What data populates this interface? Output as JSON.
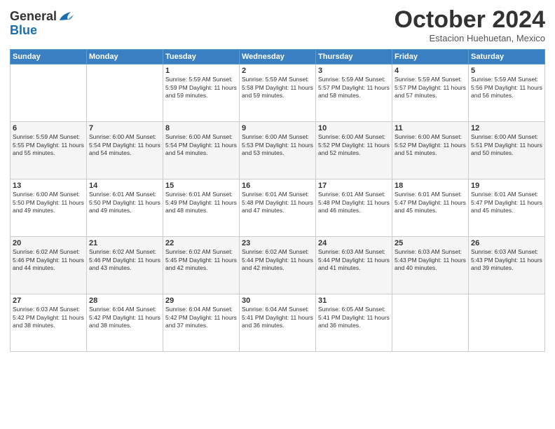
{
  "header": {
    "logo_general": "General",
    "logo_blue": "Blue",
    "month_title": "October 2024",
    "location": "Estacion Huehuetan, Mexico"
  },
  "weekdays": [
    "Sunday",
    "Monday",
    "Tuesday",
    "Wednesday",
    "Thursday",
    "Friday",
    "Saturday"
  ],
  "weeks": [
    [
      {
        "day": "",
        "info": ""
      },
      {
        "day": "",
        "info": ""
      },
      {
        "day": "1",
        "info": "Sunrise: 5:59 AM\nSunset: 5:59 PM\nDaylight: 11 hours and 59 minutes."
      },
      {
        "day": "2",
        "info": "Sunrise: 5:59 AM\nSunset: 5:58 PM\nDaylight: 11 hours and 59 minutes."
      },
      {
        "day": "3",
        "info": "Sunrise: 5:59 AM\nSunset: 5:57 PM\nDaylight: 11 hours and 58 minutes."
      },
      {
        "day": "4",
        "info": "Sunrise: 5:59 AM\nSunset: 5:57 PM\nDaylight: 11 hours and 57 minutes."
      },
      {
        "day": "5",
        "info": "Sunrise: 5:59 AM\nSunset: 5:56 PM\nDaylight: 11 hours and 56 minutes."
      }
    ],
    [
      {
        "day": "6",
        "info": "Sunrise: 5:59 AM\nSunset: 5:55 PM\nDaylight: 11 hours and 55 minutes."
      },
      {
        "day": "7",
        "info": "Sunrise: 6:00 AM\nSunset: 5:54 PM\nDaylight: 11 hours and 54 minutes."
      },
      {
        "day": "8",
        "info": "Sunrise: 6:00 AM\nSunset: 5:54 PM\nDaylight: 11 hours and 54 minutes."
      },
      {
        "day": "9",
        "info": "Sunrise: 6:00 AM\nSunset: 5:53 PM\nDaylight: 11 hours and 53 minutes."
      },
      {
        "day": "10",
        "info": "Sunrise: 6:00 AM\nSunset: 5:52 PM\nDaylight: 11 hours and 52 minutes."
      },
      {
        "day": "11",
        "info": "Sunrise: 6:00 AM\nSunset: 5:52 PM\nDaylight: 11 hours and 51 minutes."
      },
      {
        "day": "12",
        "info": "Sunrise: 6:00 AM\nSunset: 5:51 PM\nDaylight: 11 hours and 50 minutes."
      }
    ],
    [
      {
        "day": "13",
        "info": "Sunrise: 6:00 AM\nSunset: 5:50 PM\nDaylight: 11 hours and 49 minutes."
      },
      {
        "day": "14",
        "info": "Sunrise: 6:01 AM\nSunset: 5:50 PM\nDaylight: 11 hours and 49 minutes."
      },
      {
        "day": "15",
        "info": "Sunrise: 6:01 AM\nSunset: 5:49 PM\nDaylight: 11 hours and 48 minutes."
      },
      {
        "day": "16",
        "info": "Sunrise: 6:01 AM\nSunset: 5:48 PM\nDaylight: 11 hours and 47 minutes."
      },
      {
        "day": "17",
        "info": "Sunrise: 6:01 AM\nSunset: 5:48 PM\nDaylight: 11 hours and 46 minutes."
      },
      {
        "day": "18",
        "info": "Sunrise: 6:01 AM\nSunset: 5:47 PM\nDaylight: 11 hours and 45 minutes."
      },
      {
        "day": "19",
        "info": "Sunrise: 6:01 AM\nSunset: 5:47 PM\nDaylight: 11 hours and 45 minutes."
      }
    ],
    [
      {
        "day": "20",
        "info": "Sunrise: 6:02 AM\nSunset: 5:46 PM\nDaylight: 11 hours and 44 minutes."
      },
      {
        "day": "21",
        "info": "Sunrise: 6:02 AM\nSunset: 5:46 PM\nDaylight: 11 hours and 43 minutes."
      },
      {
        "day": "22",
        "info": "Sunrise: 6:02 AM\nSunset: 5:45 PM\nDaylight: 11 hours and 42 minutes."
      },
      {
        "day": "23",
        "info": "Sunrise: 6:02 AM\nSunset: 5:44 PM\nDaylight: 11 hours and 42 minutes."
      },
      {
        "day": "24",
        "info": "Sunrise: 6:03 AM\nSunset: 5:44 PM\nDaylight: 11 hours and 41 minutes."
      },
      {
        "day": "25",
        "info": "Sunrise: 6:03 AM\nSunset: 5:43 PM\nDaylight: 11 hours and 40 minutes."
      },
      {
        "day": "26",
        "info": "Sunrise: 6:03 AM\nSunset: 5:43 PM\nDaylight: 11 hours and 39 minutes."
      }
    ],
    [
      {
        "day": "27",
        "info": "Sunrise: 6:03 AM\nSunset: 5:42 PM\nDaylight: 11 hours and 38 minutes."
      },
      {
        "day": "28",
        "info": "Sunrise: 6:04 AM\nSunset: 5:42 PM\nDaylight: 11 hours and 38 minutes."
      },
      {
        "day": "29",
        "info": "Sunrise: 6:04 AM\nSunset: 5:42 PM\nDaylight: 11 hours and 37 minutes."
      },
      {
        "day": "30",
        "info": "Sunrise: 6:04 AM\nSunset: 5:41 PM\nDaylight: 11 hours and 36 minutes."
      },
      {
        "day": "31",
        "info": "Sunrise: 6:05 AM\nSunset: 5:41 PM\nDaylight: 11 hours and 36 minutes."
      },
      {
        "day": "",
        "info": ""
      },
      {
        "day": "",
        "info": ""
      }
    ]
  ]
}
